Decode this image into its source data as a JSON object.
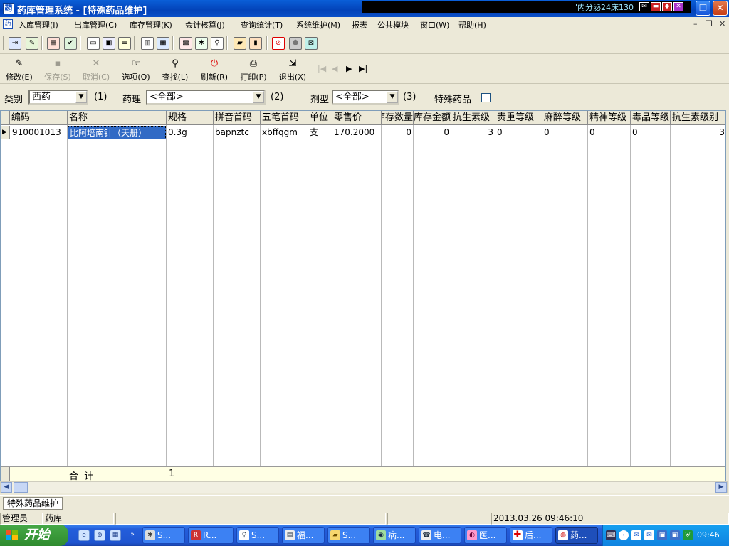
{
  "window": {
    "title": "药库管理系统 - [特殊药品维护]",
    "scroll_message": "\"内分泌24床130",
    "app_icon_glyph": "药"
  },
  "menu": {
    "items": [
      "入库管理(I)",
      "出库管理(C)",
      "库存管理(K)",
      "会计核算(J)",
      "查询统计(T)",
      "系统维护(M)",
      "报表",
      "公共模块",
      "窗口(W)",
      "帮助(H)"
    ]
  },
  "actions": {
    "modify": "修改(E)",
    "save": "保存(S)",
    "cancel": "取消(C)",
    "options": "选项(O)",
    "find": "查找(L)",
    "refresh": "刷新(R)",
    "print": "打印(P)",
    "exit": "退出(X)"
  },
  "filters": {
    "category_label": "类别",
    "category_value": "西药",
    "category_hotkey": "(1)",
    "pharmacology_label": "药理",
    "pharmacology_value": "<全部>",
    "pharmacology_hotkey": "(2)",
    "dosage_label": "剂型",
    "dosage_value": "<全部>",
    "dosage_hotkey": "(3)",
    "special_label": "特殊药品",
    "special_checked": false
  },
  "grid": {
    "columns": [
      "编码",
      "名称",
      "规格",
      "拼音首码",
      "五笔首码",
      "单位",
      "零售价",
      "库存数量",
      "库存金额",
      "抗生素级",
      "贵重等级",
      "麻醉等级",
      "精神等级",
      "毒品等级",
      "抗生素级别"
    ],
    "rows": [
      [
        "910001013",
        "比阿培南针（天册）",
        "0.3g",
        "bapnztc",
        "xbffqgm",
        "支",
        "170.2000",
        "0",
        "0",
        "3",
        "0",
        "0",
        "0",
        "0",
        "3"
      ]
    ],
    "footer": {
      "label": "合  计",
      "spec_total": "1"
    }
  },
  "mdi_tab": "特殊药品维护",
  "status": {
    "role": "管理员",
    "module": "药库",
    "datetime": "2013.03.26 09:46:10"
  },
  "taskbar": {
    "start_label": "开始",
    "tasks": [
      "S...",
      "R...",
      "S...",
      "福...",
      "S...",
      "病...",
      "电...",
      "医...",
      "后...",
      "药..."
    ],
    "clock": "09:46"
  }
}
